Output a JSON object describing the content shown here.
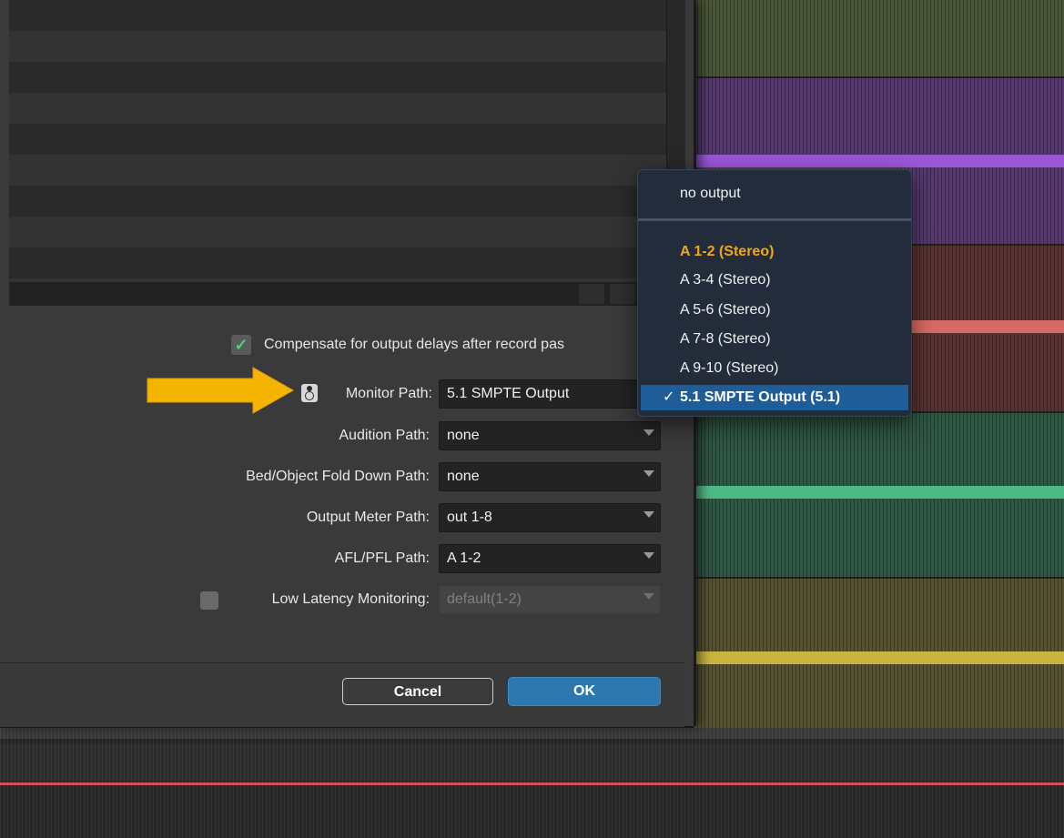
{
  "dialog": {
    "compensate": {
      "label": "Compensate for output delays after record pas",
      "checked": true
    },
    "fields": [
      {
        "label": "Monitor Path:",
        "value": "5.1 SMPTE Output"
      },
      {
        "label": "Audition Path:",
        "value": "none"
      },
      {
        "label": "Bed/Object Fold Down Path:",
        "value": "none"
      },
      {
        "label": "Output Meter Path:",
        "value": "out 1-8"
      },
      {
        "label": "AFL/PFL Path:",
        "value": "A 1-2"
      }
    ],
    "low_latency": {
      "label": "Low Latency Monitoring:",
      "value": "default(1-2)",
      "checked": false,
      "disabled": true
    },
    "buttons": {
      "cancel": "Cancel",
      "ok": "OK"
    }
  },
  "dropdown": {
    "header_item": "no output",
    "items": [
      {
        "label": "A 1-2 (Stereo)",
        "state": "highlighted"
      },
      {
        "label": "A 3-4 (Stereo)",
        "state": "normal"
      },
      {
        "label": "A 5-6 (Stereo)",
        "state": "normal"
      },
      {
        "label": "A 7-8 (Stereo)",
        "state": "normal"
      },
      {
        "label": "A 9-10 (Stereo)",
        "state": "normal"
      },
      {
        "label": "5.1 SMPTE Output (5.1)",
        "state": "checked"
      }
    ],
    "check_glyph": "✓"
  },
  "colors": {
    "accent_blue": "#2e78b0",
    "menu_highlight_text": "#f0a818",
    "arrow": "#f5b400",
    "track_green": "#4c5a36",
    "track_purple": "#5b3a73",
    "track_red": "#5e3333",
    "track_teal": "#2f5a45",
    "track_olive": "#5a5530"
  },
  "icons": {
    "monitor": "speaker-icon",
    "annotation": "arrow-right-icon"
  }
}
